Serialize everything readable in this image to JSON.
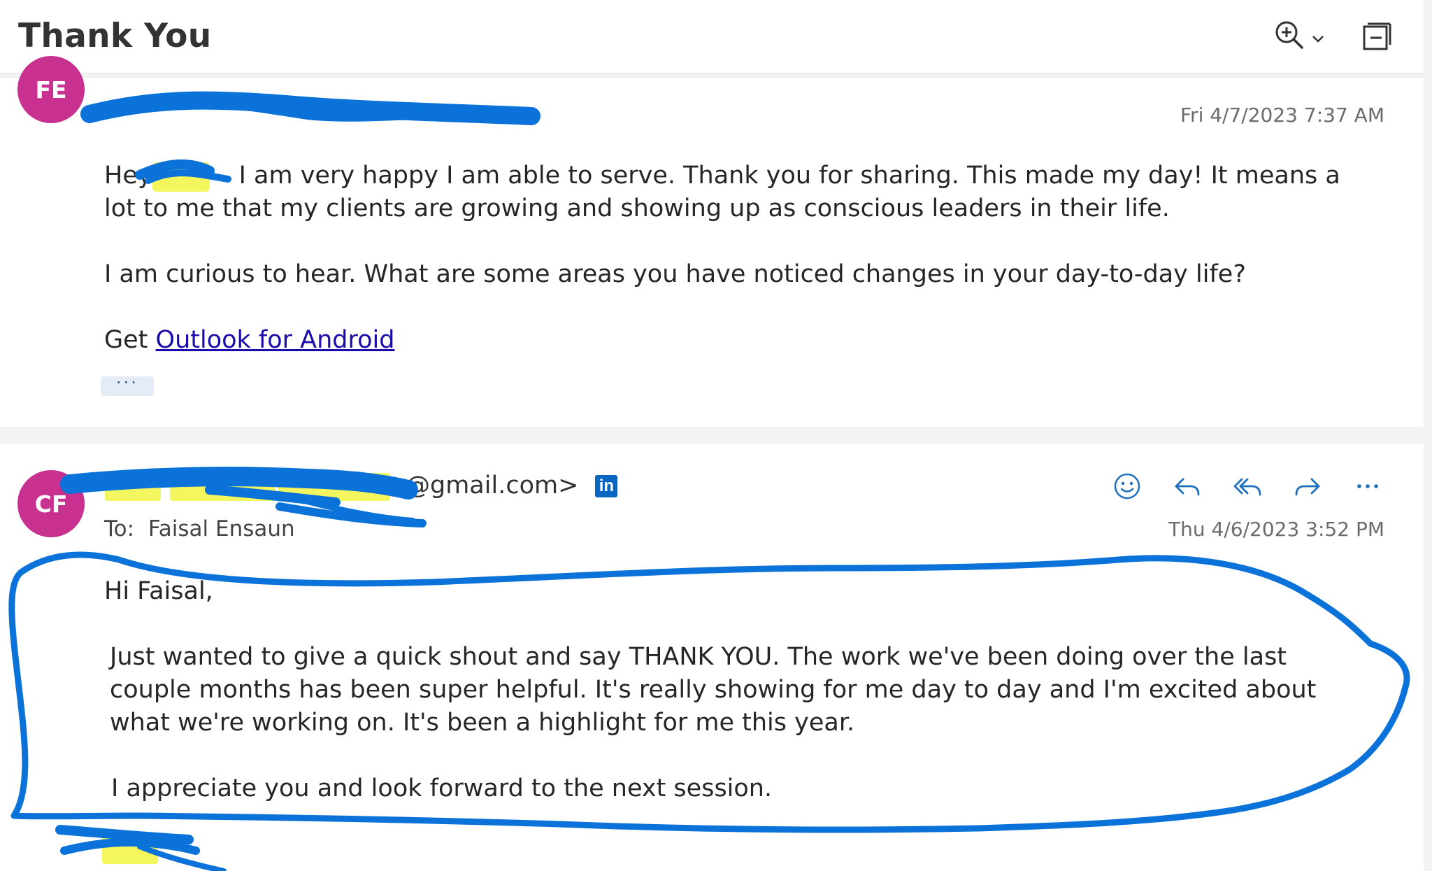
{
  "header": {
    "subject": "Thank You",
    "zoom_icon": "zoom-in-icon",
    "popout_icon": "popout-window-icon"
  },
  "messages": [
    {
      "avatar_initials": "FE",
      "sender_visible": "",
      "date": "Fri 4/7/2023 7:37 AM",
      "body": {
        "line1_prefix": "Hey",
        "line1_rest": "I am very happy I am able to serve. Thank you for sharing. This made my day! It means a lot to me that my clients are growing and showing up as conscious leaders in their life.",
        "para2": "I am curious to hear. What are some areas you have noticed changes in your day-to-day life?",
        "get_prefix": "Get ",
        "link_text": "Outlook for Android"
      },
      "more_label": "···"
    },
    {
      "avatar_initials": "CF",
      "sender_visible": "@gmail.com>",
      "to_label": "To:",
      "to_name": "Faisal Ensaun",
      "date": "Thu 4/6/2023 3:52 PM",
      "actions": [
        "emoji-icon",
        "reply-icon",
        "reply-all-icon",
        "forward-icon",
        "more-options-icon"
      ],
      "body": {
        "greeting": "Hi Faisal,",
        "para1": "Just wanted to give a quick shout and say THANK YOU. The work we've been doing over the last couple months has been super helpful. It's really showing for me day to day and I'm excited about what we're working on. It's been a highlight for me this year.",
        "para2": "I appreciate you and look forward to the next session."
      }
    }
  ],
  "colors": {
    "avatar": "#c8318f",
    "marker_blue": "#0a72d9",
    "highlight_yellow": "#f2f542",
    "link": "#1a0dab"
  }
}
